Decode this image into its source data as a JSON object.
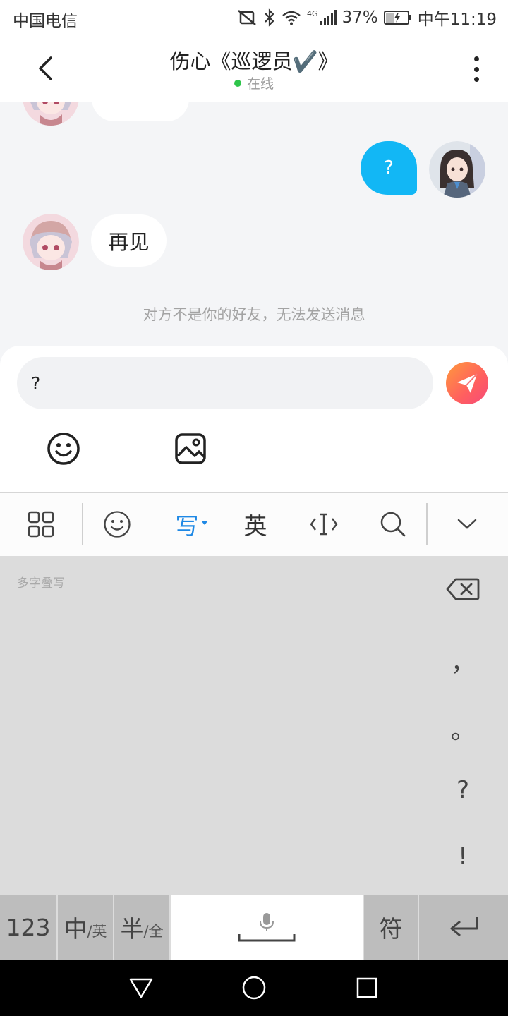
{
  "status_bar": {
    "carrier": "中国电信",
    "network": "4G",
    "battery": "37%",
    "time": "中午11:19"
  },
  "header": {
    "title": "伤心《巡逻员✔️》",
    "status": "在线",
    "back_icon": "chevron-left-icon",
    "more_icon": "more-vertical-icon"
  },
  "chat": {
    "messages": [
      {
        "from": "other",
        "text": ""
      },
      {
        "from": "me",
        "text": "?"
      },
      {
        "from": "other",
        "text": "再见"
      }
    ],
    "notice": "对方不是你的好友，无法发送消息"
  },
  "composer": {
    "input_value": "?",
    "send_icon": "paper-plane-icon",
    "tools": [
      "smiley-icon",
      "image-icon"
    ]
  },
  "ime_toolbar": {
    "items": [
      "grid-menu-icon",
      "emoji-icon",
      "写",
      "英",
      "cursor-icon",
      "search-icon",
      "chevron-down-icon"
    ],
    "handwrite_label": "写",
    "english_label": "英"
  },
  "handwriting": {
    "hint": "多字叠写",
    "punctuation": [
      "，",
      "。",
      "?",
      "!"
    ]
  },
  "keyboard_row": {
    "numbers": "123",
    "lang_main": "中",
    "lang_alt": "/英",
    "width_main": "半",
    "width_alt": "/全",
    "symbols": "符"
  },
  "colors": {
    "my_bubble": "#12b7f5",
    "online_dot": "#2ec54a",
    "ime_active": "#1e88e5",
    "send_gradient_start": "#ff9a3c",
    "send_gradient_end": "#f64a7a"
  }
}
